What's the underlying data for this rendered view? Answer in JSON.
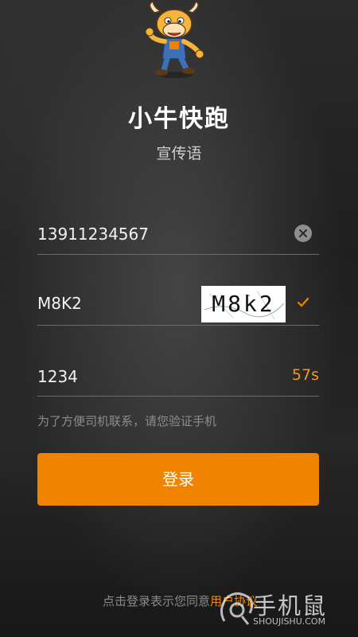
{
  "header": {
    "app_title": "小牛快跑",
    "slogan": "宣传语"
  },
  "form": {
    "phone_value": "13911234567",
    "captcha_value": "M8K2",
    "captcha_image_text": "M8k2",
    "sms_code_value": "1234",
    "countdown": "57s",
    "hint": "为了方便司机联系，请您验证手机"
  },
  "login_button_label": "登录",
  "agreement": {
    "text": "点击登录表示您同意",
    "link": "用户协议"
  },
  "watermark": {
    "brand": "手机鼠",
    "url": "SHOUJISHU.COM"
  },
  "colors": {
    "accent": "#f08300",
    "countdown": "#f39a1d"
  }
}
